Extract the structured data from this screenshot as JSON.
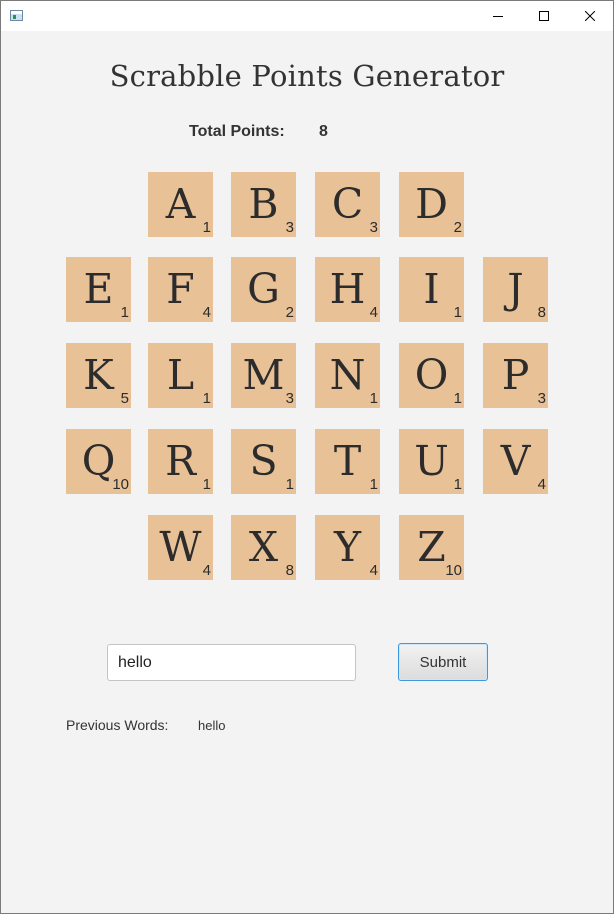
{
  "window": {
    "controls": {
      "minimize_icon": "minimize-icon",
      "maximize_icon": "maximize-icon",
      "close_icon": "close-icon"
    }
  },
  "app": {
    "title": "Scrabble Points Generator",
    "total_points_label": "Total Points:",
    "total_points_value": "8"
  },
  "tiles": [
    {
      "letter": "A",
      "value": "1"
    },
    {
      "letter": "B",
      "value": "3"
    },
    {
      "letter": "C",
      "value": "3"
    },
    {
      "letter": "D",
      "value": "2"
    },
    {
      "letter": "E",
      "value": "1"
    },
    {
      "letter": "F",
      "value": "4"
    },
    {
      "letter": "G",
      "value": "2"
    },
    {
      "letter": "H",
      "value": "4"
    },
    {
      "letter": "I",
      "value": "1"
    },
    {
      "letter": "J",
      "value": "8"
    },
    {
      "letter": "K",
      "value": "5"
    },
    {
      "letter": "L",
      "value": "1"
    },
    {
      "letter": "M",
      "value": "3"
    },
    {
      "letter": "N",
      "value": "1"
    },
    {
      "letter": "O",
      "value": "1"
    },
    {
      "letter": "P",
      "value": "3"
    },
    {
      "letter": "Q",
      "value": "10"
    },
    {
      "letter": "R",
      "value": "1"
    },
    {
      "letter": "S",
      "value": "1"
    },
    {
      "letter": "T",
      "value": "1"
    },
    {
      "letter": "U",
      "value": "1"
    },
    {
      "letter": "V",
      "value": "4"
    },
    {
      "letter": "W",
      "value": "4"
    },
    {
      "letter": "X",
      "value": "8"
    },
    {
      "letter": "Y",
      "value": "4"
    },
    {
      "letter": "Z",
      "value": "10"
    }
  ],
  "form": {
    "word_input_value": "hello",
    "submit_label": "Submit"
  },
  "history": {
    "label": "Previous Words:",
    "words": "hello"
  },
  "colors": {
    "tile": "#e8c197",
    "background": "#f3f3f3",
    "button_focus": "#3d98e0"
  }
}
